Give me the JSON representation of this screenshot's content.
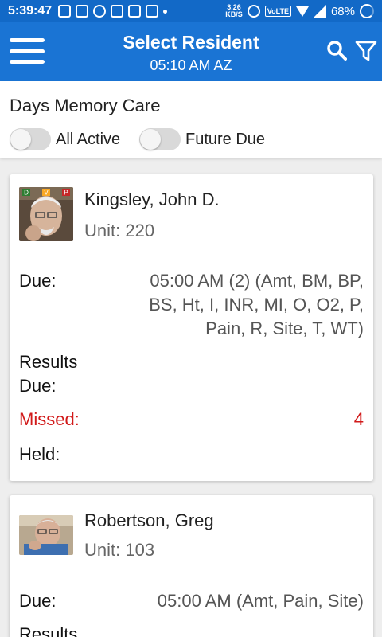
{
  "status_bar": {
    "time": "5:39:47",
    "network_speed_value": "3.26",
    "network_speed_unit": "KB/S",
    "volte": "VoLTE",
    "battery": "68%"
  },
  "app_bar": {
    "title": "Select Resident",
    "subtitle": "05:10 AM AZ",
    "icons": [
      "menu-icon",
      "search-icon",
      "filter-icon"
    ]
  },
  "facility": {
    "name": "Days Memory Care",
    "toggles": [
      {
        "label": "All Active",
        "on": false
      },
      {
        "label": "Future Due",
        "on": false
      }
    ]
  },
  "residents": [
    {
      "name": "Kingsley, John D.",
      "unit": "Unit: 220",
      "badges": [
        "D",
        "V",
        "P"
      ],
      "due_label": "Due:",
      "due_lines": [
        "05:00 AM (2) (Amt, BM, BP,",
        "BS, Ht, I, INR, MI, O, O2, P,",
        "Pain, R, Site, T, WT)"
      ],
      "results_label_1": "Results",
      "results_label_2": "Due:",
      "missed_label": "Missed:",
      "missed_value": "4",
      "held_label": "Held:"
    },
    {
      "name": "Robertson, Greg",
      "unit": "Unit: 103",
      "due_label": "Due:",
      "due_value": "05:00 AM (Amt, Pain, Site)",
      "results_label_1": "Results"
    }
  ],
  "colors": {
    "status_bar": "#1269c7",
    "app_bar": "#1a74d4",
    "missed": "#d11a1a"
  }
}
